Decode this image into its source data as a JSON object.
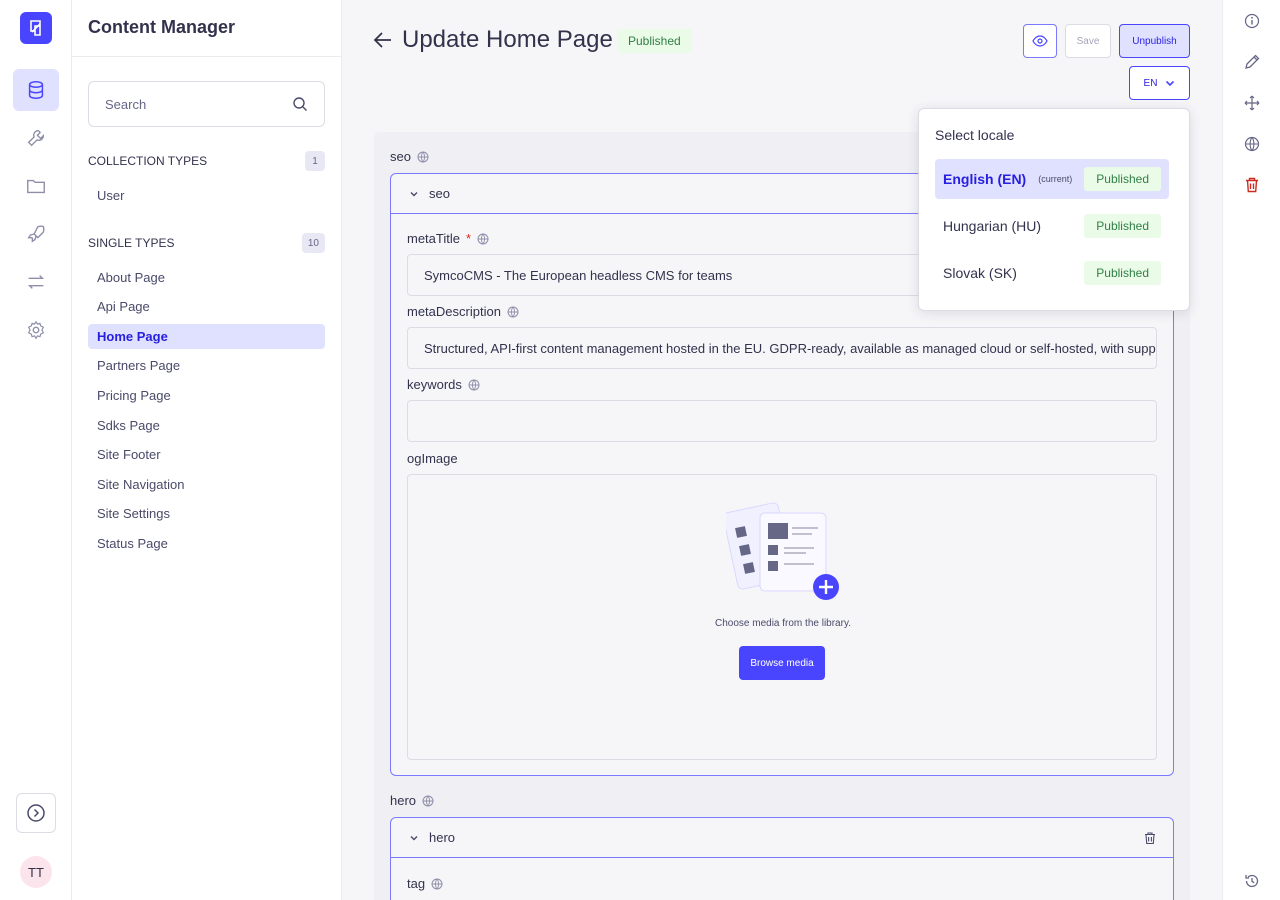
{
  "sidebar": {
    "rail_icons": [
      "database-icon",
      "wrench-icon",
      "folder-icon",
      "rocket-icon",
      "arrows-icon",
      "gear-icon"
    ],
    "avatar_initials": "TT"
  },
  "subnav": {
    "title": "Content Manager",
    "search_placeholder": "Search",
    "collection_types": {
      "label": "COLLECTION TYPES",
      "count": "1",
      "items": [
        "User"
      ]
    },
    "single_types": {
      "label": "SINGLE TYPES",
      "count": "10",
      "items": [
        "About Page",
        "Api Page",
        "Home Page",
        "Partners Page",
        "Pricing Page",
        "Sdks Page",
        "Site Footer",
        "Site Navigation",
        "Site Settings",
        "Status Page"
      ],
      "active": "Home Page"
    }
  },
  "header": {
    "title": "Update Home Page",
    "status": "Published",
    "save_label": "Save",
    "unpublish_label": "Unpublish",
    "locale_value": "EN"
  },
  "form": {
    "seo_label": "seo",
    "seo_component_title": "seo",
    "meta_title_label": "metaTitle",
    "meta_title_required": "*",
    "meta_title_value": "SymcoCMS - The European headless CMS for teams",
    "meta_description_label": "metaDescription",
    "meta_description_value": "Structured, API-first content management hosted in the EU. GDPR-ready, available as managed cloud or self-hosted, with support in Eng",
    "keywords_label": "keywords",
    "keywords_value": "",
    "og_image_label": "ogImage",
    "media_text": "Choose media from the library.",
    "browse_media_label": "Browse media",
    "hero_label": "hero",
    "hero_component_title": "hero",
    "tag_label": "tag"
  },
  "locale_popover": {
    "title": "Select locale",
    "locales": [
      {
        "name": "English (EN)",
        "current_tag": "(current)",
        "status": "Published"
      },
      {
        "name": "Hungarian (HU)",
        "current_tag": "",
        "status": "Published"
      },
      {
        "name": "Slovak (SK)",
        "current_tag": "",
        "status": "Published"
      }
    ]
  },
  "colors": {
    "primary": "#4945ff",
    "primary_light": "#e0e0ff",
    "success_bg": "#eafbe7",
    "success_text": "#328048",
    "danger": "#d02b20"
  }
}
